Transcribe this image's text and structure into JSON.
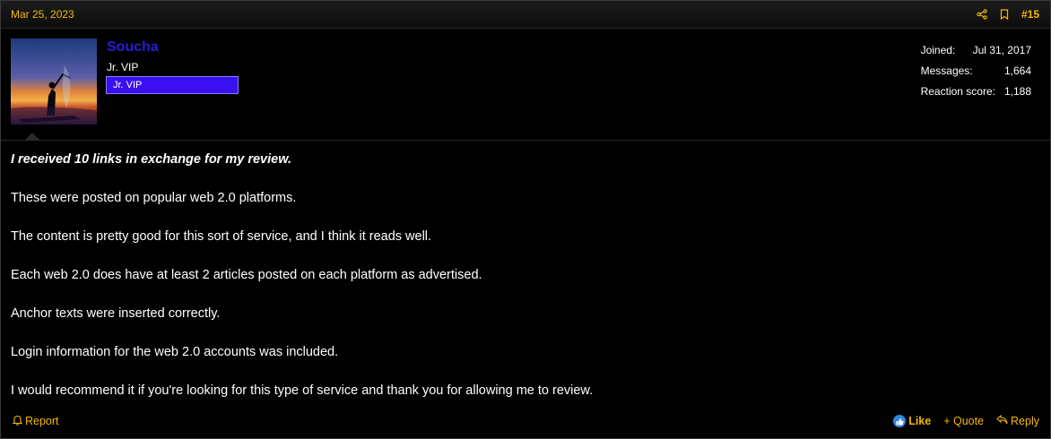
{
  "header": {
    "date": "Mar 25, 2023",
    "post_number": "#15"
  },
  "user": {
    "name": "Soucha",
    "title": "Jr. VIP",
    "banner": "Jr. VIP",
    "stats": [
      {
        "label": "Joined:",
        "value": "Jul 31, 2017"
      },
      {
        "label": "Messages:",
        "value": "1,664"
      },
      {
        "label": "Reaction score:",
        "value": "1,188"
      }
    ]
  },
  "message": {
    "lead": "I received 10 links in exchange for my review.",
    "paragraphs": [
      "These were posted on popular web 2.0 platforms.",
      "The content is pretty good for this sort of service, and I think it reads well.",
      "Each web 2.0 does have at least 2 articles posted on each platform as advertised.",
      "Anchor texts were inserted correctly.",
      "Login information for the web 2.0 accounts was included.",
      "I would recommend it if you're looking for this type of service and thank you for allowing me to review."
    ]
  },
  "footer": {
    "report": "Report",
    "like": "Like",
    "quote": "+ Quote",
    "reply": "Reply"
  },
  "colors": {
    "accent": "#f5b800",
    "username": "#2a1bd6",
    "banner": "#3a10f0",
    "like_badge": "#2d88e6"
  },
  "icons": [
    "share-icon",
    "bookmark-icon",
    "bell-icon",
    "thumbs-up-icon",
    "reply-arrow-icon"
  ]
}
